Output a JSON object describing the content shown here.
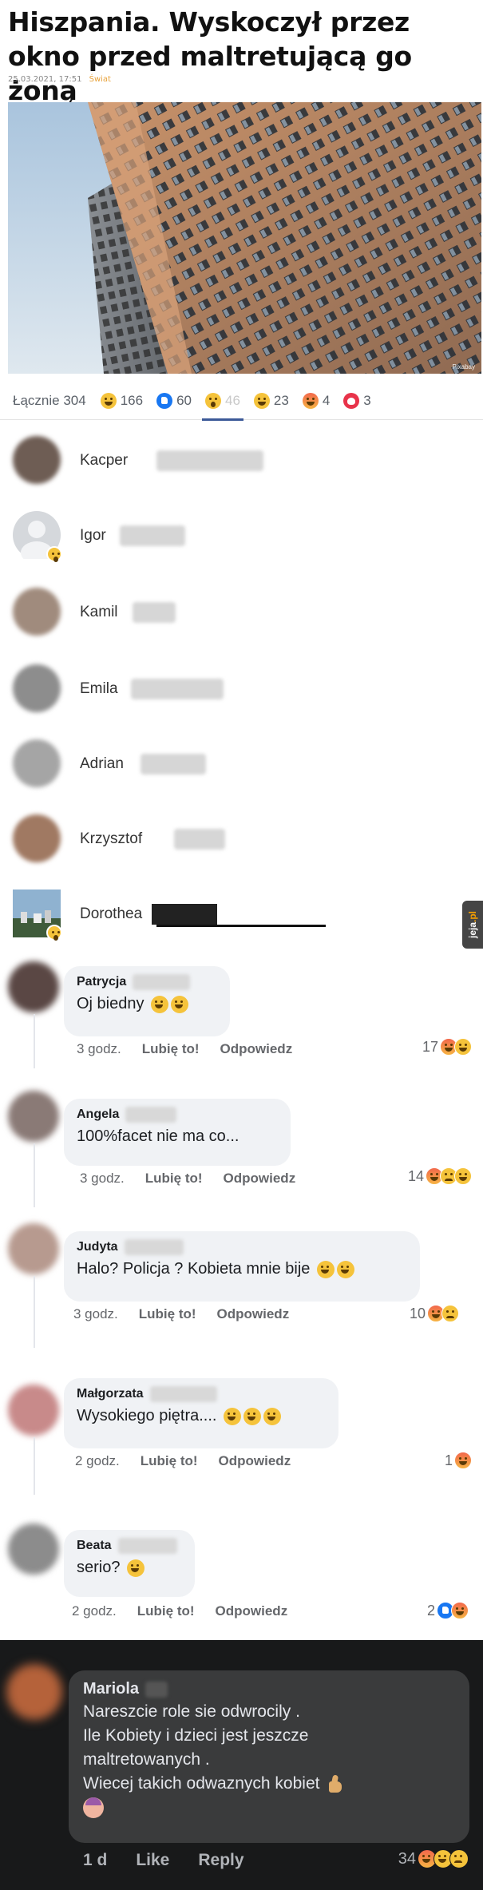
{
  "article": {
    "title": "Hiszpania. Wyskoczył przez okno przed maltretującą go żoną",
    "date": "25.03.2021, 17:51",
    "category": "Świat",
    "image_credit": "Pixabay"
  },
  "reaction_tabs": {
    "total_label": "Łącznie 304",
    "tabs": [
      {
        "icon": "haha-icon",
        "count": "166"
      },
      {
        "icon": "like-icon",
        "count": "60"
      },
      {
        "icon": "wow-icon",
        "count": "46",
        "active": true
      },
      {
        "icon": "care-icon",
        "count": "23"
      },
      {
        "icon": "angry-icon",
        "count": "4"
      },
      {
        "icon": "love-icon",
        "count": "3"
      }
    ]
  },
  "reactors": [
    {
      "name": "Kacper"
    },
    {
      "name": "Igor"
    },
    {
      "name": "Kamil"
    },
    {
      "name": "Emila"
    },
    {
      "name": "Adrian"
    },
    {
      "name": "Krzysztof"
    },
    {
      "name": "Dorothea"
    }
  ],
  "side_tab": {
    "label_a": "jeja",
    "label_b": ".pl"
  },
  "comments": [
    {
      "author": "Patrycja",
      "text": "Oj biedny",
      "time": "3 godz.",
      "like": "Lubię to!",
      "reply": "Odpowiedz",
      "reactions_count": "17"
    },
    {
      "author": "Angela",
      "text": "100%facet nie ma co...",
      "time": "3 godz.",
      "like": "Lubię to!",
      "reply": "Odpowiedz",
      "reactions_count": "14"
    },
    {
      "author": "Judyta",
      "text": "Halo? Policja ? Kobieta mnie bije",
      "time": "3 godz.",
      "like": "Lubię to!",
      "reply": "Odpowiedz",
      "reactions_count": "10"
    },
    {
      "author": "Małgorzata",
      "text": "Wysokiego piętra....",
      "time": "2 godz.",
      "like": "Lubię to!",
      "reply": "Odpowiedz",
      "reactions_count": "1"
    },
    {
      "author": "Beata",
      "text": "serio?",
      "time": "2 godz.",
      "like": "Lubię to!",
      "reply": "Odpowiedz",
      "reactions_count": "2"
    }
  ],
  "dark_comment": {
    "author": "Mariola",
    "lines": [
      "Nareszcie role sie odwrocily .",
      "Ile Kobiety i dzieci jest jeszcze",
      "maltretowanych .",
      "Wiecej takich odwaznych kobiet"
    ],
    "time": "1 d",
    "like": "Like",
    "reply": "Reply",
    "reactions_count": "34"
  },
  "colors": {
    "accent_tab": "#3b5998",
    "dark_bg": "#18191a",
    "dark_bubble": "#3a3b3c",
    "category": "#e8a33d"
  }
}
